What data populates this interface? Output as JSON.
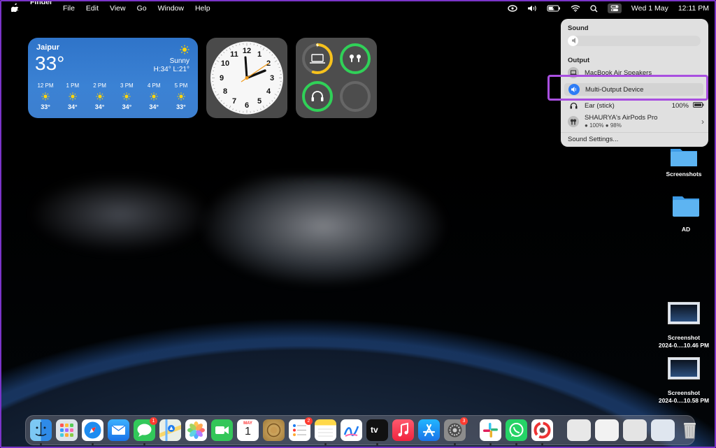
{
  "menubar": {
    "app_name": "Finder",
    "menus": [
      "File",
      "Edit",
      "View",
      "Go",
      "Window",
      "Help"
    ],
    "date": "Wed 1 May",
    "time": "12:11 PM"
  },
  "weather": {
    "city": "Jaipur",
    "temp": "33°",
    "condition": "Sunny",
    "hilo": "H:34° L:21°",
    "hours": [
      {
        "time": "12 PM",
        "temp": "33°"
      },
      {
        "time": "1 PM",
        "temp": "34°"
      },
      {
        "time": "2 PM",
        "temp": "34°"
      },
      {
        "time": "3 PM",
        "temp": "34°"
      },
      {
        "time": "4 PM",
        "temp": "34°"
      },
      {
        "time": "5 PM",
        "temp": "33°"
      }
    ]
  },
  "clock": {
    "numerals": [
      "12",
      "1",
      "2",
      "3",
      "4",
      "5",
      "6",
      "7",
      "8",
      "9",
      "10",
      "11"
    ]
  },
  "batteries": {
    "mac_level": 0.55
  },
  "sound_panel": {
    "title": "Sound",
    "volume_level": 0.05,
    "output_label": "Output",
    "devices": {
      "macbook": "MacBook Air Speakers",
      "multi": "Multi-Output Device",
      "ear": "Ear (stick)",
      "ear_batt": "100%",
      "airpods": "SHAURYA's AirPods Pro",
      "airpods_left": "100%",
      "airpods_right": "98%"
    },
    "settings_link": "Sound Settings..."
  },
  "desktop": {
    "screenshots_folder": "Screenshots",
    "ad_folder": "AD",
    "shot1_label": "Screenshot",
    "shot1_name": "2024-0....10.46 PM",
    "shot2_label": "Screenshot",
    "shot2_name": "2024-0....10.58 PM"
  },
  "dock": {
    "messages_badge": "1",
    "reminders_badge": "2",
    "settings_badge": "3",
    "calendar_month": "MAY",
    "calendar_day": "1",
    "tv_label": "tv"
  },
  "colors": {
    "accent": "#2d7cf6",
    "highlight": "#a94fe0",
    "weather_bg": "#3b82d4",
    "battery_yellow": "#f7c21c",
    "battery_green": "#30d158"
  }
}
